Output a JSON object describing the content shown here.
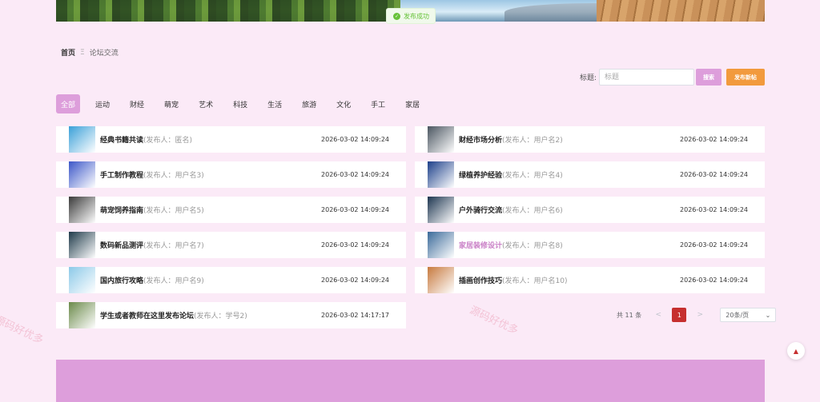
{
  "toast": {
    "message": "发布成功"
  },
  "breadcrumb": {
    "home": "首页",
    "separator": "Ξ",
    "current": "论坛交流"
  },
  "search": {
    "label": "标题:",
    "placeholder": "标题",
    "search_button": "搜索",
    "publish_button": "发布新帖"
  },
  "tabs": [
    {
      "label": "全部",
      "active": true
    },
    {
      "label": "运动"
    },
    {
      "label": "财经"
    },
    {
      "label": "萌宠"
    },
    {
      "label": "艺术"
    },
    {
      "label": "科技"
    },
    {
      "label": "生活"
    },
    {
      "label": "旅游"
    },
    {
      "label": "文化"
    },
    {
      "label": "手工"
    },
    {
      "label": "家居"
    }
  ],
  "posts": [
    {
      "title": "经典书籍共读",
      "publisher": "(发布人：匿名)",
      "date": "2026-03-02 14:09:24",
      "thumb_color": "#3aa0d8"
    },
    {
      "title": "财经市场分析",
      "publisher": "(发布人：用户名2)",
      "date": "2026-03-02 14:09:24",
      "thumb_color": "#4a5560"
    },
    {
      "title": "手工制作教程",
      "publisher": "(发布人：用户名3)",
      "date": "2026-03-02 14:09:24",
      "thumb_color": "#3b56c8"
    },
    {
      "title": "绿植养护经验",
      "publisher": "(发布人：用户名4)",
      "date": "2026-03-02 14:09:24",
      "thumb_color": "#1c3f8a"
    },
    {
      "title": "萌宠饲养指南",
      "publisher": "(发布人：用户名5)",
      "date": "2026-03-02 14:09:24",
      "thumb_color": "#3a3a3a"
    },
    {
      "title": "户外骑行交流",
      "publisher": "(发布人：用户名6)",
      "date": "2026-03-02 14:09:24",
      "thumb_color": "#1d3550"
    },
    {
      "title": "数码新品测评",
      "publisher": "(发布人：用户名7)",
      "date": "2026-03-02 14:09:24",
      "thumb_color": "#1f3a4a"
    },
    {
      "title": "家居装修设计",
      "publisher": "(发布人：用户名8)",
      "date": "2026-03-02 14:09:24",
      "thumb_color": "#3a6a9a",
      "highlight": true
    },
    {
      "title": "国内旅行攻略",
      "publisher": "(发布人：用户名9)",
      "date": "2026-03-02 14:09:24",
      "thumb_color": "#8cc9e8"
    },
    {
      "title": "插画创作技巧",
      "publisher": "(发布人：用户名10)",
      "date": "2026-03-02 14:09:24",
      "thumb_color": "#c77a3e"
    },
    {
      "title": "学生或者教师在这里发布论坛",
      "publisher": "(发布人：学号2)",
      "date": "2026-03-02 14:17:17",
      "thumb_color": "#6b8a4a"
    }
  ],
  "pagination": {
    "total": "共 11 条",
    "prev": "<",
    "page": "1",
    "next": ">",
    "page_size": "20条/页"
  },
  "watermark": "源码好优多",
  "colors": {
    "accent": "#dd9edb",
    "publish": "#f29a3d",
    "active_page": "#c62f2f",
    "background": "#fbeaf7"
  }
}
